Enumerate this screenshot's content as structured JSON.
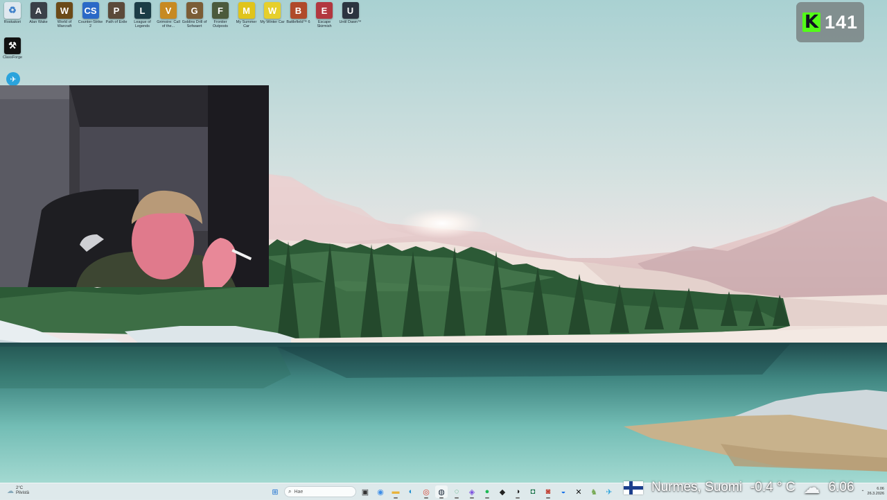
{
  "desktop": {
    "icons_row1": [
      {
        "label": "Roskakori",
        "icon": "recycle-bin-icon",
        "color": "#dfe8ef",
        "glyph": "♻"
      },
      {
        "label": "Alan Wake",
        "icon": "alan-wake-icon",
        "color": "#3a4048",
        "glyph": "A"
      },
      {
        "label": "World of Warcraft",
        "icon": "warcraft-icon",
        "color": "#6b4a18",
        "glyph": "W"
      },
      {
        "label": "Counter-Strike 2",
        "icon": "counter-strike-icon",
        "color": "#2a69c7",
        "glyph": "CS"
      },
      {
        "label": "Path of Exile",
        "icon": "path-of-exile-icon",
        "color": "#5b4a3a",
        "glyph": "P"
      },
      {
        "label": "League of Legends",
        "icon": "league-of-legends-icon",
        "color": "#1b3c46",
        "glyph": "L"
      },
      {
        "label": "Grimoire: Call of the...",
        "icon": "call-of-the-icon",
        "color": "#c78a21",
        "glyph": "V"
      },
      {
        "label": "Goblins Drill of Sofwaert",
        "icon": "goblins-icon",
        "color": "#7b5d36",
        "glyph": "G"
      },
      {
        "label": "Frontier Outposts",
        "icon": "outposts-icon",
        "color": "#4b5a3c",
        "glyph": "F"
      },
      {
        "label": "My Summer Car",
        "icon": "my-summer-car-icon",
        "color": "#e0c41b",
        "glyph": "M"
      },
      {
        "label": "My Winter Car",
        "icon": "my-winter-car-icon",
        "color": "#e6cf2c",
        "glyph": "W"
      },
      {
        "label": "Battlefield™ 6",
        "icon": "battlefield-icon",
        "color": "#b04a2a",
        "glyph": "B"
      },
      {
        "label": "Escape Skirmish",
        "icon": "escape-skirmish-icon",
        "color": "#b2373f",
        "glyph": "E"
      },
      {
        "label": "Until Dawn™",
        "icon": "until-dawn-icon",
        "color": "#2c3440",
        "glyph": "U"
      }
    ],
    "icons_row2": [
      {
        "label": "ClassForge",
        "icon": "classforge-icon",
        "color": "#111111",
        "glyph": "⚒"
      }
    ],
    "telegram_icon": "telegram-icon"
  },
  "kick": {
    "logo": "K",
    "count": "141"
  },
  "overlay": {
    "location": "Nurmes, Suomi",
    "temperature": "-0.4 ° C",
    "weather_icon": "cloud-icon",
    "time": "6.06"
  },
  "taskbar": {
    "weather_temp": "2°C",
    "weather_desc": "Pilvistä",
    "search_placeholder": "Hae",
    "apps": [
      {
        "name": "start-button",
        "glyph": "⊞",
        "color": "#1a6fd0"
      },
      {
        "name": "search-box"
      },
      {
        "name": "task-view-button",
        "glyph": "▣",
        "color": "#333"
      },
      {
        "name": "copilot-icon",
        "glyph": "◉",
        "color": "#3c8de8"
      },
      {
        "name": "file-explorer-icon",
        "glyph": "▬",
        "color": "#e8b33a"
      },
      {
        "name": "edge-icon",
        "glyph": "◐",
        "color": "#1d8fcf"
      },
      {
        "name": "chrome-icon",
        "glyph": "◎",
        "color": "#d94030"
      },
      {
        "name": "steam-icon",
        "glyph": "◍",
        "color": "#1b2838"
      },
      {
        "name": "whatsapp-icon",
        "glyph": "◌",
        "color": "#25a15c"
      },
      {
        "name": "messenger-icon",
        "glyph": "◈",
        "color": "#7b4de0"
      },
      {
        "name": "spotify-icon",
        "glyph": "●",
        "color": "#1db954"
      },
      {
        "name": "epic-games-icon",
        "glyph": "◆",
        "color": "#222"
      },
      {
        "name": "obs-icon",
        "glyph": "◑",
        "color": "#222"
      },
      {
        "name": "gamepad-icon",
        "glyph": "◘",
        "color": "#0b6a3c"
      },
      {
        "name": "record-icon",
        "glyph": "◙",
        "color": "#c0392b"
      },
      {
        "name": "app-blue-icon",
        "glyph": "◒",
        "color": "#1a73e8"
      },
      {
        "name": "capcut-icon",
        "glyph": "✕",
        "color": "#111"
      },
      {
        "name": "game-icon",
        "glyph": "♞",
        "color": "#7a5"
      },
      {
        "name": "telegram-taskbar-icon",
        "glyph": "✈",
        "color": "#2aa3dc"
      }
    ],
    "tray": {
      "chevron": "⌃",
      "clock_time": "6.06",
      "clock_date": "26.3.2026"
    }
  }
}
